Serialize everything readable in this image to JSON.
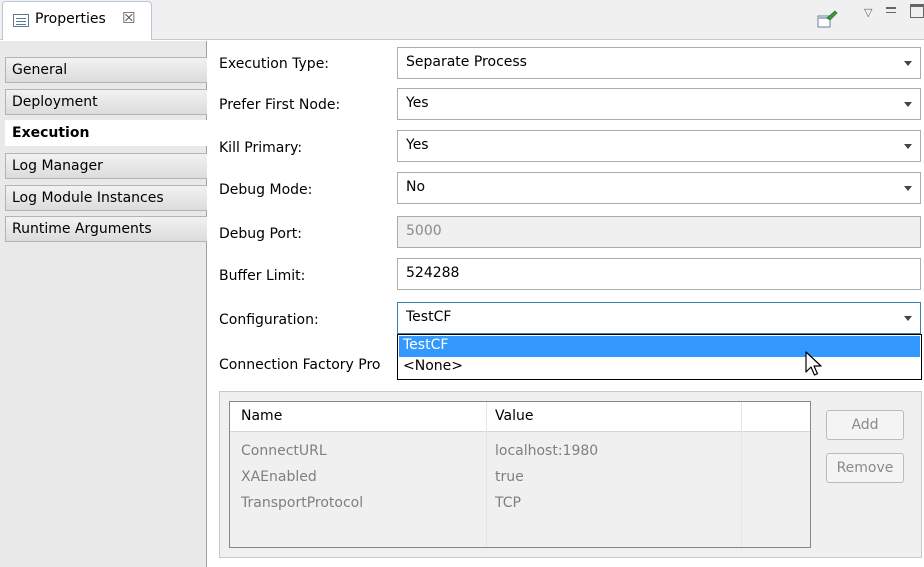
{
  "view": {
    "title": "Properties",
    "close_glyph": "☒"
  },
  "toolbar_icons": [
    "pin-icon",
    "view-menu-icon",
    "minimize-icon",
    "maximize-icon"
  ],
  "sidebar": {
    "items": [
      {
        "label": "General",
        "active": false
      },
      {
        "label": "Deployment",
        "active": false
      },
      {
        "label": "Execution",
        "active": true
      },
      {
        "label": "Log Manager",
        "active": false
      },
      {
        "label": "Log Module Instances",
        "active": false
      },
      {
        "label": "Runtime Arguments",
        "active": false
      }
    ]
  },
  "form": {
    "execution_type": {
      "label": "Execution Type:",
      "value": "Separate Process"
    },
    "prefer_first_node": {
      "label": "Prefer First Node:",
      "value": "Yes"
    },
    "kill_primary": {
      "label": "Kill Primary:",
      "value": "Yes"
    },
    "debug_mode": {
      "label": "Debug Mode:",
      "value": "No"
    },
    "debug_port": {
      "label": "Debug Port:",
      "value": "5000"
    },
    "buffer_limit": {
      "label": "Buffer Limit:",
      "value": "524288"
    },
    "configuration": {
      "label": "Configuration:",
      "value": "TestCF"
    },
    "connection_factory_label": "Connection Factory Pro"
  },
  "dropdown": {
    "options": [
      {
        "label": "TestCF",
        "selected": true
      },
      {
        "label": "<None>",
        "selected": false
      }
    ]
  },
  "table": {
    "columns": [
      "Name",
      "Value"
    ],
    "rows": [
      {
        "name": "ConnectURL",
        "value": "localhost:1980"
      },
      {
        "name": "XAEnabled",
        "value": "true"
      },
      {
        "name": "TransportProtocol",
        "value": "TCP"
      }
    ]
  },
  "buttons": {
    "add": "Add",
    "remove": "Remove"
  },
  "colors": {
    "selection": "#3399ff",
    "active_tab_border": "#b8c7d9"
  }
}
